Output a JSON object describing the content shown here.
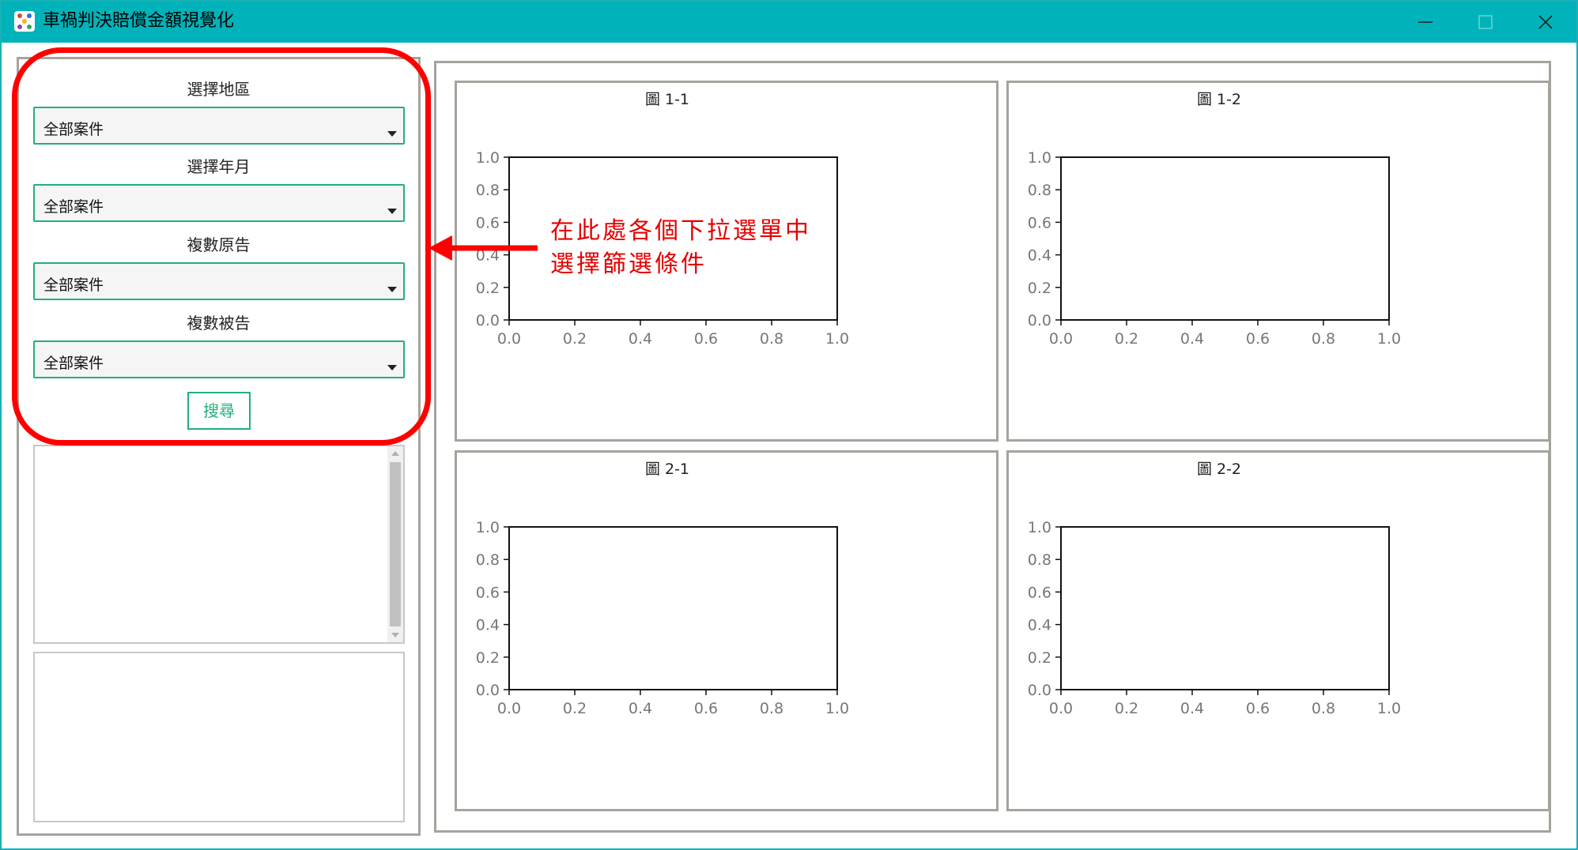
{
  "window": {
    "title": "車禍判決賠償金額視覺化",
    "controls": {
      "minimize": "minimize-icon",
      "maximize": "maximize-icon",
      "close": "close-icon"
    }
  },
  "filters": [
    {
      "label": "選擇地區",
      "value": "全部案件"
    },
    {
      "label": "選擇年月",
      "value": "全部案件"
    },
    {
      "label": "複數原告",
      "value": "全部案件"
    },
    {
      "label": "複數被告",
      "value": "全部案件"
    }
  ],
  "search_button": "搜尋",
  "annotation": {
    "line1": "在此處各個下拉選單中",
    "line2": "選擇篩選條件",
    "color": "#e40000"
  },
  "chart_data": [
    {
      "type": "scatter",
      "title": "圖 1-1",
      "x": [],
      "y": [],
      "xlim": [
        0.0,
        1.0
      ],
      "ylim": [
        0.0,
        1.0
      ],
      "xticks": [
        "0.0",
        "0.2",
        "0.4",
        "0.6",
        "0.8",
        "1.0"
      ],
      "yticks": [
        "0.0",
        "0.2",
        "0.4",
        "0.6",
        "0.8",
        "1.0"
      ]
    },
    {
      "type": "scatter",
      "title": "圖 1-2",
      "x": [],
      "y": [],
      "xlim": [
        0.0,
        1.0
      ],
      "ylim": [
        0.0,
        1.0
      ],
      "xticks": [
        "0.0",
        "0.2",
        "0.4",
        "0.6",
        "0.8",
        "1.0"
      ],
      "yticks": [
        "0.0",
        "0.2",
        "0.4",
        "0.6",
        "0.8",
        "1.0"
      ]
    },
    {
      "type": "scatter",
      "title": "圖 2-1",
      "x": [],
      "y": [],
      "xlim": [
        0.0,
        1.0
      ],
      "ylim": [
        0.0,
        1.0
      ],
      "xticks": [
        "0.0",
        "0.2",
        "0.4",
        "0.6",
        "0.8",
        "1.0"
      ],
      "yticks": [
        "0.0",
        "0.2",
        "0.4",
        "0.6",
        "0.8",
        "1.0"
      ]
    },
    {
      "type": "scatter",
      "title": "圖 2-2",
      "x": [],
      "y": [],
      "xlim": [
        0.0,
        1.0
      ],
      "ylim": [
        0.0,
        1.0
      ],
      "xticks": [
        "0.0",
        "0.2",
        "0.4",
        "0.6",
        "0.8",
        "1.0"
      ],
      "yticks": [
        "0.0",
        "0.2",
        "0.4",
        "0.6",
        "0.8",
        "1.0"
      ]
    }
  ],
  "colors": {
    "titlebar": "#00b3ba",
    "accent_green": "#22b07a",
    "frame_gray": "#a5a39c",
    "highlight_red": "#ff0000"
  }
}
